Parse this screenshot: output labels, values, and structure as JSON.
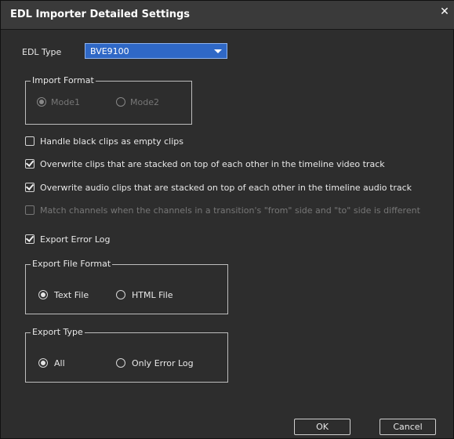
{
  "window": {
    "title": "EDL Importer Detailed Settings",
    "close_icon": "close-icon"
  },
  "edl_type": {
    "label": "EDL Type",
    "value": "BVE9100"
  },
  "import_format": {
    "legend": "Import Format",
    "mode1": "Mode1",
    "mode2": "Mode2",
    "selected": "Mode1",
    "enabled": false
  },
  "options": {
    "handle_black": "Handle black clips as empty clips",
    "overwrite_video": "Overwrite clips that are stacked on top of each other in the timeline video track",
    "overwrite_audio": "Overwrite audio clips that are stacked on top of each other in the timeline audio track",
    "match_channels": "Match channels when the channels in a transition's \"from\" side and \"to\" side is different",
    "export_error_log": "Export Error Log"
  },
  "checks": {
    "handle_black": false,
    "overwrite_video": true,
    "overwrite_audio": true,
    "match_channels": false,
    "export_error_log": true
  },
  "export_file_format": {
    "legend": "Export File Format",
    "text_file": "Text File",
    "html_file": "HTML File",
    "selected": "Text File"
  },
  "export_type": {
    "legend": "Export Type",
    "all": "All",
    "only_error_log": "Only Error Log",
    "selected": "All"
  },
  "buttons": {
    "ok": "OK",
    "cancel": "Cancel"
  }
}
